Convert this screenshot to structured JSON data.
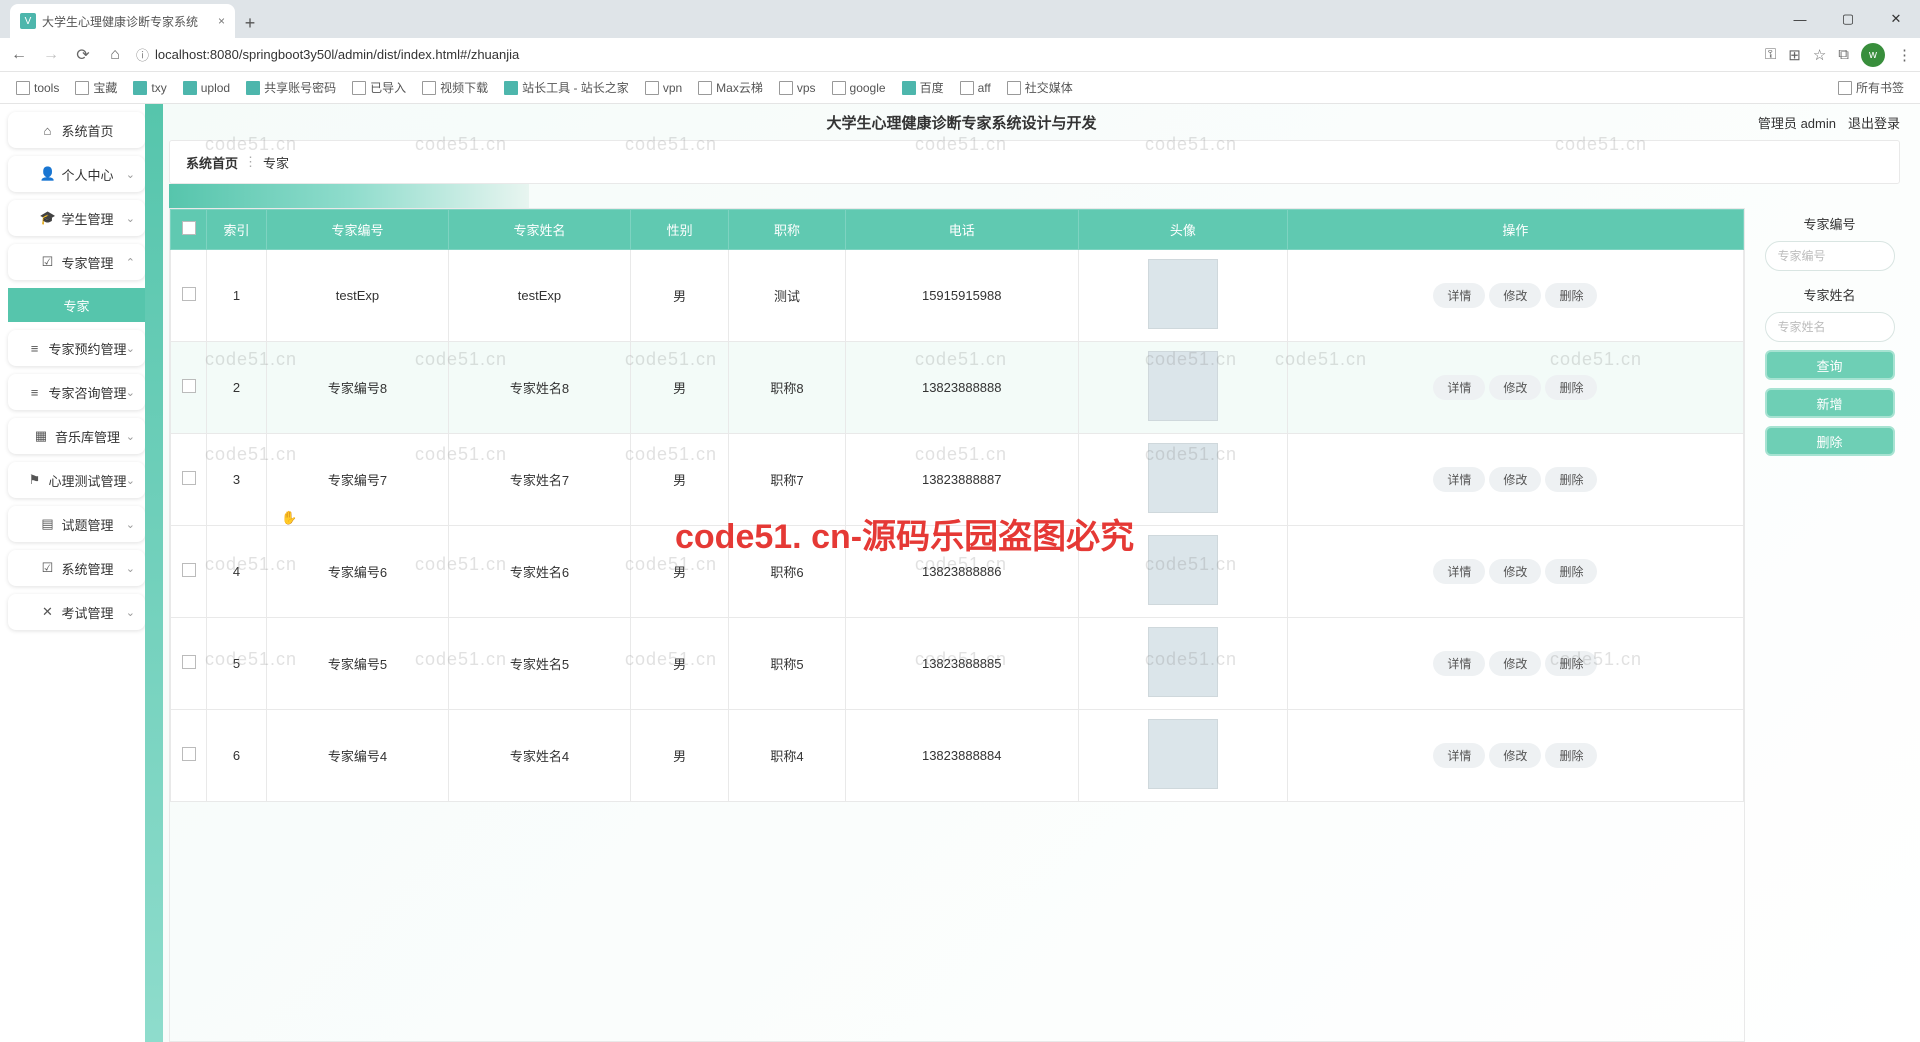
{
  "browser": {
    "tab_title": "大学生心理健康诊断专家系统",
    "url": "localhost:8080/springboot3y50l/admin/dist/index.html#/zhuanjia",
    "bookmarks": [
      "tools",
      "宝藏",
      "txy",
      "uplod",
      "共享账号密码",
      "已导入",
      "视频下载",
      "站长工具 - 站长之家",
      "vpn",
      "Max云梯",
      "vps",
      "google",
      "百度",
      "aff",
      "社交媒体"
    ],
    "all_bookmarks": "所有书签"
  },
  "header": {
    "title": "大学生心理健康诊断专家系统设计与开发",
    "role": "管理员",
    "user": "admin",
    "logout": "退出登录"
  },
  "breadcrumb": {
    "home": "系统首页",
    "current": "专家"
  },
  "sidebar": [
    {
      "icon": "⌂",
      "label": "系统首页",
      "chev": ""
    },
    {
      "icon": "👤",
      "label": "个人中心",
      "chev": "⌄"
    },
    {
      "icon": "🎓",
      "label": "学生管理",
      "chev": "⌄"
    },
    {
      "icon": "☑",
      "label": "专家管理",
      "chev": "⌃"
    },
    {
      "icon": "",
      "label": "专家",
      "chev": "",
      "sub": true
    },
    {
      "icon": "≡",
      "label": "专家预约管理",
      "chev": "⌄"
    },
    {
      "icon": "≡",
      "label": "专家咨询管理",
      "chev": "⌄"
    },
    {
      "icon": "▦",
      "label": "音乐库管理",
      "chev": "⌄"
    },
    {
      "icon": "⚑",
      "label": "心理测试管理",
      "chev": "⌄"
    },
    {
      "icon": "▤",
      "label": "试题管理",
      "chev": "⌄"
    },
    {
      "icon": "☑",
      "label": "系统管理",
      "chev": "⌄"
    },
    {
      "icon": "✕",
      "label": "考试管理",
      "chev": "⌄"
    }
  ],
  "table": {
    "headers": [
      "",
      "索引",
      "专家编号",
      "专家姓名",
      "性别",
      "职称",
      "电话",
      "头像",
      "操作"
    ],
    "ops": {
      "detail": "详情",
      "edit": "修改",
      "delete": "删除"
    },
    "rows": [
      {
        "idx": "1",
        "no": "testExp",
        "name": "testExp",
        "gender": "男",
        "title": "测试",
        "tel": "15915915988"
      },
      {
        "idx": "2",
        "no": "专家编号8",
        "name": "专家姓名8",
        "gender": "男",
        "title": "职称8",
        "tel": "13823888888"
      },
      {
        "idx": "3",
        "no": "专家编号7",
        "name": "专家姓名7",
        "gender": "男",
        "title": "职称7",
        "tel": "13823888887"
      },
      {
        "idx": "4",
        "no": "专家编号6",
        "name": "专家姓名6",
        "gender": "男",
        "title": "职称6",
        "tel": "13823888886"
      },
      {
        "idx": "5",
        "no": "专家编号5",
        "name": "专家姓名5",
        "gender": "男",
        "title": "职称5",
        "tel": "13823888885"
      },
      {
        "idx": "6",
        "no": "专家编号4",
        "name": "专家姓名4",
        "gender": "男",
        "title": "职称4",
        "tel": "13823888884"
      }
    ]
  },
  "search": {
    "label_no": "专家编号",
    "ph_no": "专家编号",
    "label_name": "专家姓名",
    "ph_name": "专家姓名",
    "query": "查询",
    "add": "新增",
    "delete": "删除"
  },
  "watermark": {
    "big": "code51. cn-源码乐园盗图必究",
    "small": "code51.cn"
  }
}
